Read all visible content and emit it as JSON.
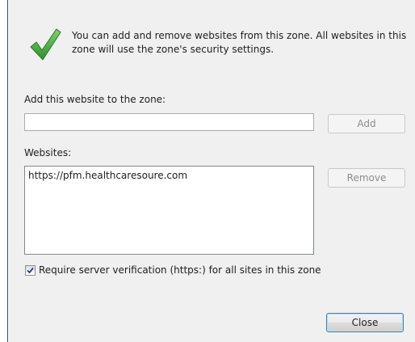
{
  "info": {
    "icon": "checkmark-icon",
    "text": "You can add and remove websites from this zone. All websites in this zone will use the zone's security settings."
  },
  "add_section": {
    "label": "Add this website to the zone:",
    "input_value": "",
    "add_button": "Add"
  },
  "websites_section": {
    "label": "Websites:",
    "items": [
      "https://pfm.healthcaresoure.com"
    ],
    "remove_button": "Remove"
  },
  "verification": {
    "checked": true,
    "label": "Require server verification (https:) for all sites in this zone"
  },
  "footer": {
    "close_button": "Close"
  },
  "colors": {
    "check_green": "#3aa23a",
    "dialog_bg": "#f0f0f0",
    "frame_border": "#2b4e7a"
  }
}
